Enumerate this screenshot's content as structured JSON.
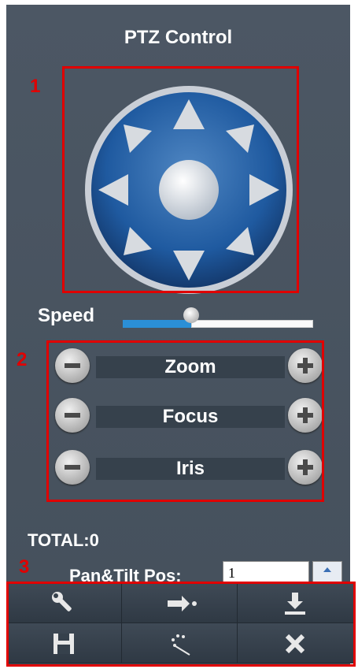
{
  "panel": {
    "title": "PTZ Control",
    "annotations": [
      "1",
      "2",
      "3"
    ],
    "speed": {
      "label": "Speed",
      "value_fraction": 0.36
    },
    "lens_controls": [
      {
        "label": "Zoom"
      },
      {
        "label": "Focus"
      },
      {
        "label": "Iris"
      }
    ],
    "total": "TOTAL:0",
    "pan_tilt": {
      "label": "Pan&Tilt Pos:",
      "value": "1"
    },
    "toolbar": {
      "items": [
        "settings-icon",
        "go-to-preset-icon",
        "download-icon",
        "save-icon",
        "pattern-icon",
        "close-icon"
      ]
    }
  },
  "colors": {
    "panel_bg": "#4c5764",
    "annotation": "#e00000",
    "slider_fill": "#2b8fd6",
    "dpad_blue": "#1f5aa0"
  }
}
